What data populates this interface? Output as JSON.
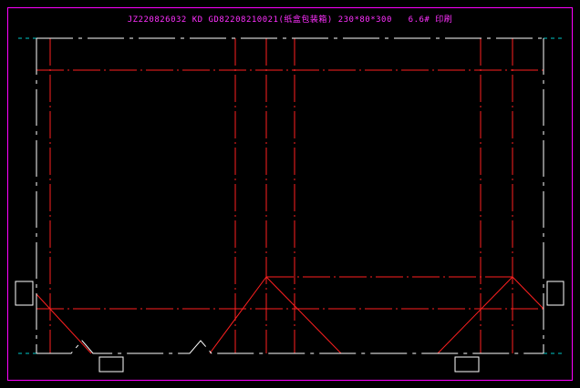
{
  "drawing": {
    "title": "JZ220826032 KD GD82208210021(纸盒包装箱) 230*80*300   6.6# 印刷",
    "colors": {
      "background": "#000000",
      "border": "#ff00ff",
      "outline": "#ffffff",
      "fold_line": "#ff2020",
      "center_mark": "#00c8c8",
      "title": "#ff30ff"
    }
  }
}
